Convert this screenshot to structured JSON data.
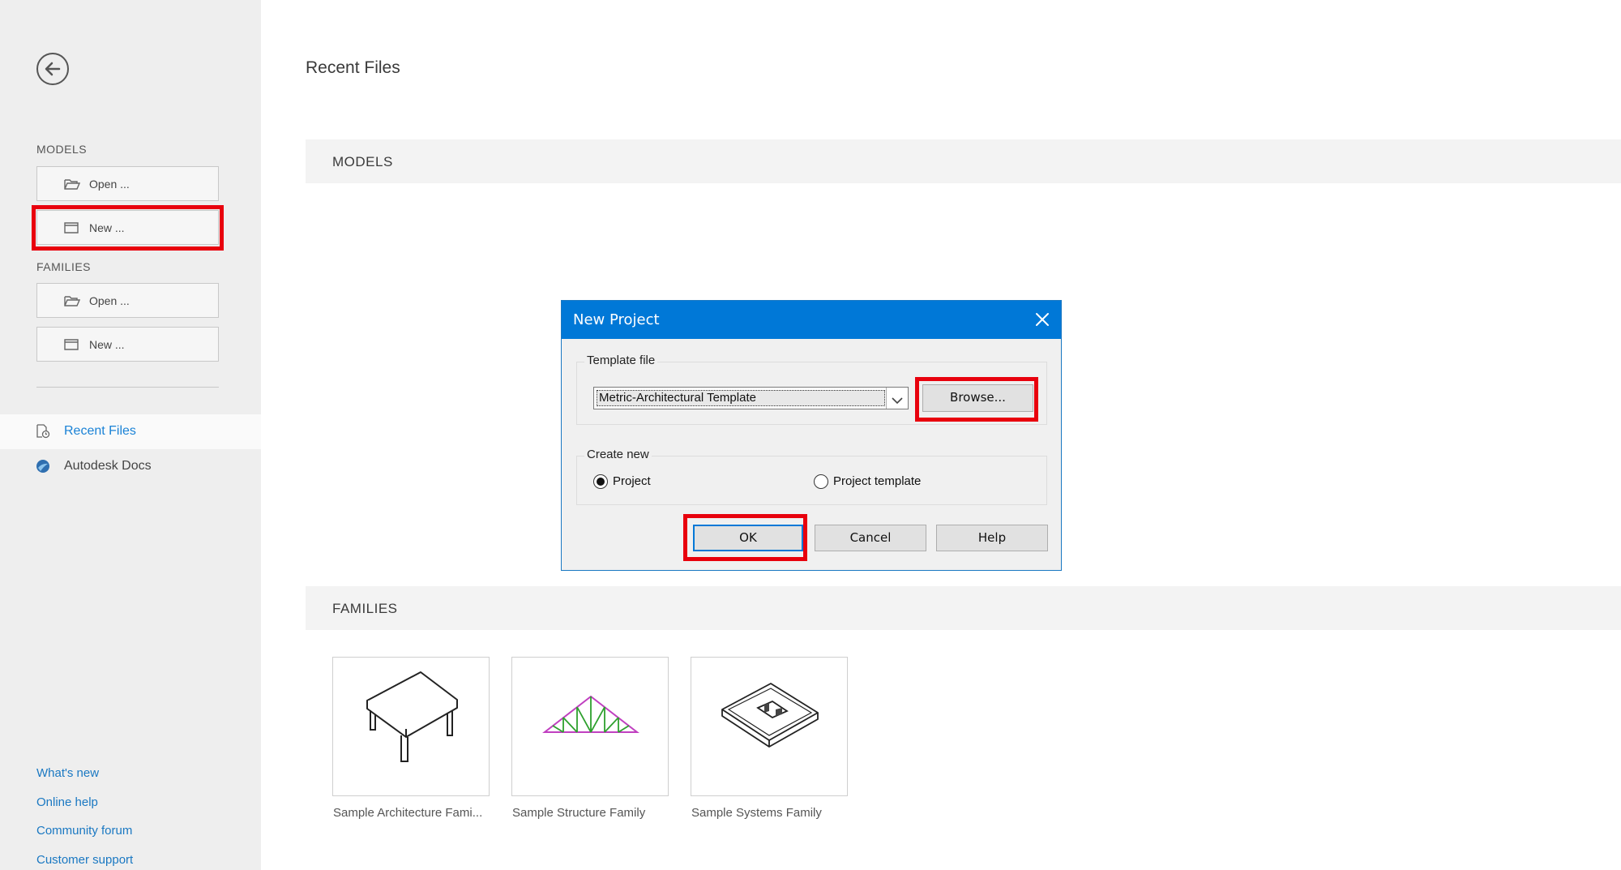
{
  "sidebar": {
    "models_heading": "MODELS",
    "models_open_label": "Open ...",
    "models_new_label": "New ...",
    "families_heading": "FAMILIES",
    "families_open_label": "Open ...",
    "families_new_label": "New ...",
    "nav_recent_files": "Recent Files",
    "nav_autodesk_docs": "Autodesk Docs",
    "footer_whats_new": "What's new",
    "footer_online_help": "Online help",
    "footer_community_forum": "Community forum",
    "footer_customer_support": "Customer support"
  },
  "main": {
    "title": "Recent Files",
    "models_section": "MODELS",
    "families_section": "FAMILIES",
    "families": [
      {
        "label": "Sample Architecture Fami...",
        "icon": "table-furniture-icon"
      },
      {
        "label": "Sample Structure Family",
        "icon": "roof-truss-icon"
      },
      {
        "label": "Sample Systems Family",
        "icon": "duct-fitting-icon"
      }
    ]
  },
  "dialog": {
    "title": "New Project",
    "template_group_label": "Template file",
    "template_value": "Metric-Architectural Template",
    "browse_label": "Browse...",
    "create_group_label": "Create new",
    "radio_project": "Project",
    "radio_project_template": "Project template",
    "selected_option": "Project",
    "ok_label": "OK",
    "cancel_label": "Cancel",
    "help_label": "Help"
  },
  "colors": {
    "accent": "#0078d7",
    "highlight_box": "#e8000d",
    "link": "#1a78c2",
    "sidebar_bg": "#eeeeee"
  }
}
